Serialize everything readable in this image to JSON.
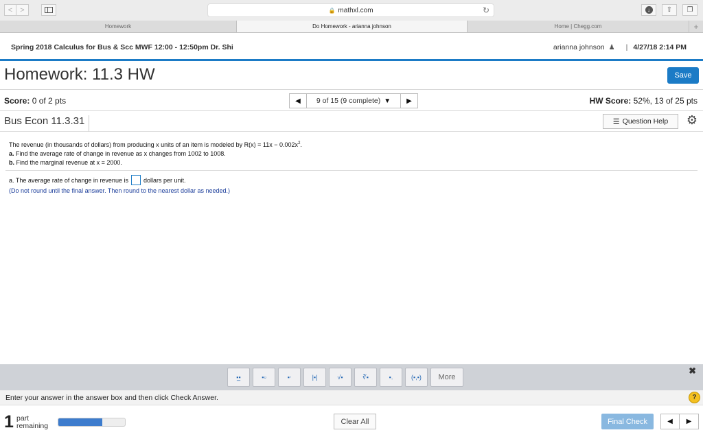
{
  "browser": {
    "url": "mathxl.com",
    "tabs": [
      "Homework",
      "Do Homework - arianna johnson",
      "Home | Chegg.com"
    ]
  },
  "course": {
    "title": "Spring 2018 Calculus for Bus & Scc MWF 12:00 - 12:50pm Dr. Shi",
    "user": "arianna johnson",
    "separator": "|",
    "datetime": "4/27/18 2:14 PM"
  },
  "homework": {
    "title": "Homework: 11.3 HW",
    "save_label": "Save",
    "score_label": "Score:",
    "score_value": "0 of 2 pts",
    "question_position": "9 of 15 (9 complete)",
    "hw_score_label": "HW Score:",
    "hw_score_value": "52%, 13 of 25 pts"
  },
  "question": {
    "title": "Bus Econ 11.3.31",
    "help_label": "Question Help",
    "intro_text": "The revenue (in thousands of dollars) from producing x units of an item is modeled by R(x) = 11x − 0.002x",
    "intro_exp": "2",
    "part_a_label": "a.",
    "part_a_text": "Find the average rate of change in revenue as x changes from 1002 to 1008.",
    "part_b_label": "b.",
    "part_b_text": "Find the marginal revenue at x = 2000.",
    "answer_prefix": "a. The average rate of change in revenue is",
    "answer_suffix": "dollars per unit.",
    "hint": "(Do not round until the final answer. Then round to the nearest dollar as needed.)"
  },
  "palette": {
    "more_label": "More"
  },
  "footer": {
    "instruction": "Enter your answer in the answer box and then click Check Answer.",
    "parts_count": "1",
    "parts_line1": "part",
    "parts_line2": "remaining",
    "progress": 0.66,
    "clear_label": "Clear All",
    "final_label": "Final Check"
  },
  "colors": {
    "accent": "#1b7bc6",
    "hint_text": "#1a3c9a",
    "help_icon": "#f4c020"
  }
}
